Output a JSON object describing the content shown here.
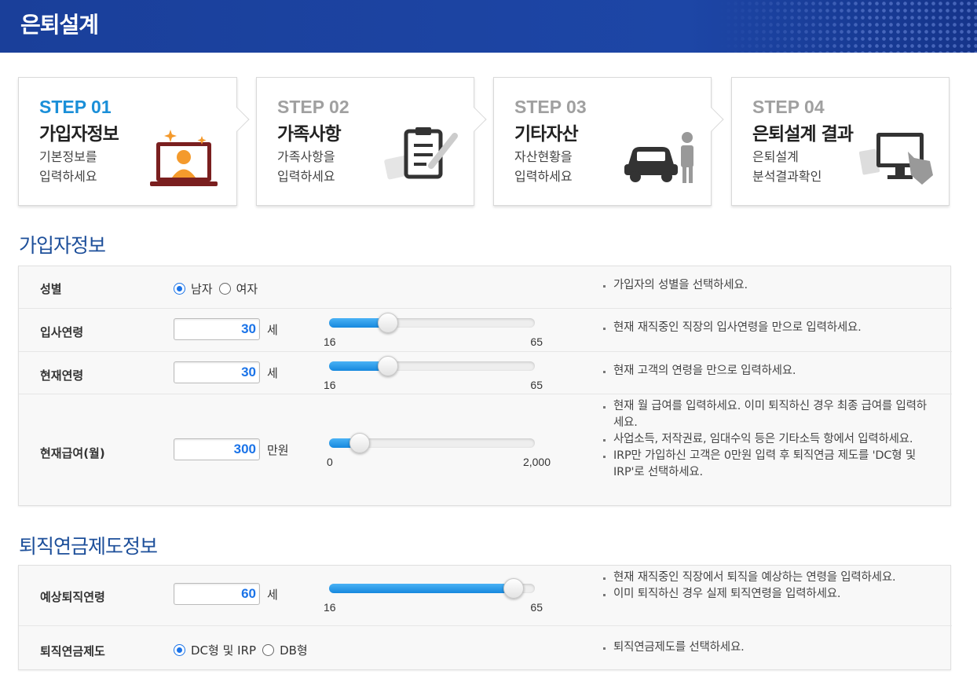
{
  "header": {
    "title": "은퇴설계"
  },
  "steps": [
    {
      "num": "STEP 01",
      "name": "가입자정보",
      "desc1": "기본정보를",
      "desc2": "입력하세요",
      "active": true
    },
    {
      "num": "STEP 02",
      "name": "가족사항",
      "desc1": "가족사항을",
      "desc2": "입력하세요",
      "active": false
    },
    {
      "num": "STEP 03",
      "name": "기타자산",
      "desc1": "자산현황을",
      "desc2": "입력하세요",
      "active": false
    },
    {
      "num": "STEP 04",
      "name": "은퇴설계 결과",
      "desc1": "은퇴설계",
      "desc2": "분석결과확인",
      "active": false
    }
  ],
  "section1": {
    "title": "가입자정보",
    "gender": {
      "label": "성별",
      "options": [
        "남자",
        "여자"
      ],
      "selected": "남자",
      "note": "가입자의 성별을 선택하세요."
    },
    "join_age": {
      "label": "입사연령",
      "value": "30",
      "unit": "세",
      "min": "16",
      "max": "65",
      "fraction": 0.286,
      "note": "현재 재직중인 직장의 입사연령을 만으로 입력하세요."
    },
    "current_age": {
      "label": "현재연령",
      "value": "30",
      "unit": "세",
      "min": "16",
      "max": "65",
      "fraction": 0.286,
      "note": "현재 고객의 연령을 만으로 입력하세요."
    },
    "salary": {
      "label": "현재급여(월)",
      "value": "300",
      "unit": "만원",
      "min": "0",
      "max": "2,000",
      "fraction": 0.15,
      "notes": [
        "현재 월 급여를 입력하세요. 이미 퇴직하신 경우 최종 급여를 입력하세요.",
        "사업소득, 저작권료, 임대수익 등은 기타소득 항에서 입력하세요.",
        "IRP만 가입하신 고객은 0만원 입력 후 퇴직연금 제도를 'DC형 및 IRP'로 선택하세요."
      ]
    }
  },
  "section2": {
    "title": "퇴직연금제도정보",
    "retire_age": {
      "label": "예상퇴직연령",
      "value": "60",
      "unit": "세",
      "min": "16",
      "max": "65",
      "fraction": 0.898,
      "notes": [
        "현재 재직중인 직장에서 퇴직을 예상하는 연령을 입력하세요.",
        "이미 퇴직하신 경우 실제 퇴직연령을 입력하세요."
      ]
    },
    "pension_type": {
      "label": "퇴직연금제도",
      "options": [
        "DC형 및 IRP",
        "DB형"
      ],
      "selected": "DC형 및 IRP",
      "note": "퇴직연금제도를 선택하세요."
    }
  },
  "colors": {
    "header_bg": "#1d46a6",
    "accent": "#1a8fd8",
    "slider_fill": "#1688de",
    "section_title": "#1d4f9a"
  }
}
